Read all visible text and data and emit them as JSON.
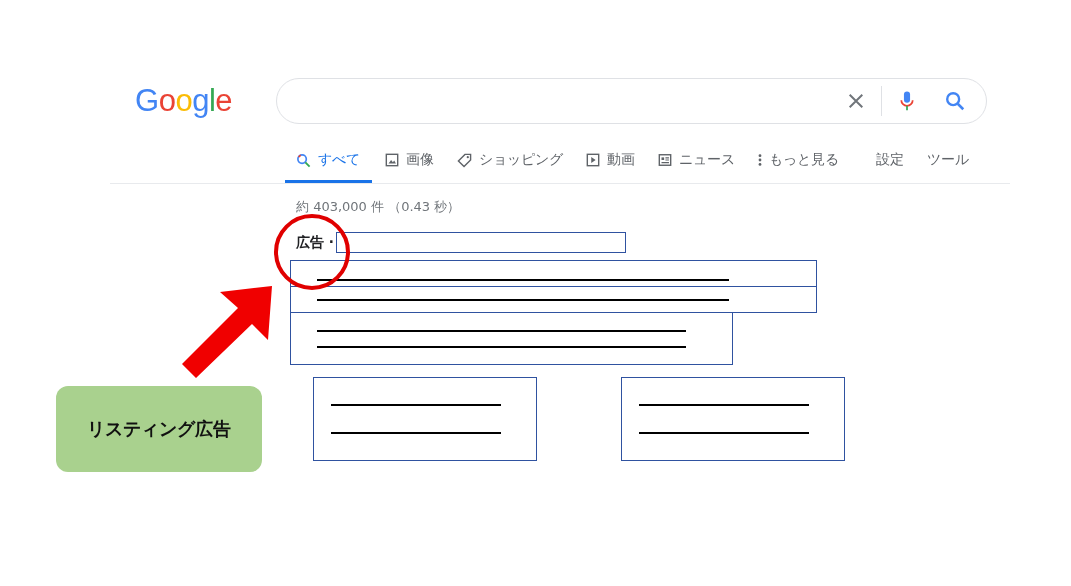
{
  "logo": {
    "text": "Google"
  },
  "tabs": [
    {
      "label": "すべて",
      "selected": true,
      "kind": "search"
    },
    {
      "label": "画像",
      "selected": false,
      "kind": "image"
    },
    {
      "label": "ショッピング",
      "selected": false,
      "kind": "tag"
    },
    {
      "label": "動画",
      "selected": false,
      "kind": "video"
    },
    {
      "label": "ニュース",
      "selected": false,
      "kind": "news"
    },
    {
      "label": "もっと見る",
      "selected": false,
      "kind": "more"
    },
    {
      "label": "設定",
      "selected": false,
      "kind": "plain"
    },
    {
      "label": "ツール",
      "selected": false,
      "kind": "plain"
    }
  ],
  "result_stats": "約 403,000 件 （0.43 秒）",
  "ad": {
    "label": "広告 ·"
  },
  "annotation": {
    "label": "リスティング広告"
  }
}
